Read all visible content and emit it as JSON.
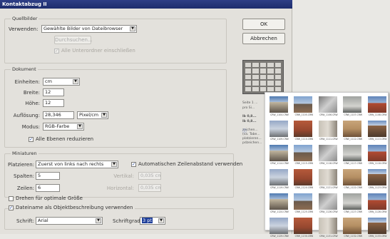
{
  "window": {
    "title": "Kontaktabzug II"
  },
  "quellbilder": {
    "legend": "Quellbilder",
    "verwenden_label": "Verwenden:",
    "verwenden_value": "Gewählte Bilder von Dateibrowser",
    "durchsuchen_label": "Durchsuchen...",
    "unterordner_label": "Alle Unterordner einschließen",
    "unterordner_checked": true
  },
  "dokument": {
    "legend": "Dokument",
    "einheiten_label": "Einheiten:",
    "einheiten_value": "cm",
    "breite_label": "Breite:",
    "breite_value": "12",
    "hoehe_label": "Höhe:",
    "hoehe_value": "12",
    "aufloesung_label": "Auflösung:",
    "aufloesung_value": "28,346",
    "aufloesung_unit": "Pixel/cm",
    "modus_label": "Modus:",
    "modus_value": "RGB-Farbe",
    "ebenen_label": "Alle Ebenen reduzieren",
    "ebenen_checked": true
  },
  "miniaturen": {
    "legend": "Miniaturen",
    "platzieren_label": "Platzieren:",
    "platzieren_value": "Zuerst von links nach rechts",
    "auto_abstand_label": "Automatischen Zeilenabstand verwenden",
    "auto_abstand_checked": true,
    "spalten_label": "Spalten:",
    "spalten_value": "5",
    "zeilen_label": "Zeilen:",
    "zeilen_value": "6",
    "vertikal_label": "Vertikal:",
    "vertikal_value": "0,035 cm",
    "horizontal_label": "Horizontal:",
    "horizontal_value": "0,035 cm",
    "drehen_label": "Drehen für optimale Größe",
    "drehen_checked": false
  },
  "dateiname": {
    "legend_checkbox_label": "Dateiname als Objektbeschreibung verwenden",
    "legend_checked": true,
    "schrift_label": "Schrift:",
    "schrift_value": "Arial",
    "schriftgrad_label": "Schriftgrad:",
    "schriftgrad_value": "3 pt"
  },
  "buttons": {
    "ok": "OK",
    "abbrechen": "Abbrechen"
  },
  "info": {
    "lines": [
      "Seite 1 ...",
      "pro Si...",
      "Ib 0,8...",
      "Ib 0,8...",
      "zeichen...",
      "(ca. Tabe...",
      "platzieren...",
      "pdzeichen..."
    ]
  },
  "contact_sheet": {
    "captions": [
      "CRW_1104.CRW",
      "CRW_1105.CRW",
      "CRW_1106.CRW",
      "CRW_1107.CRW",
      "CRW_1108.CRW",
      "CRW_1109.CRW",
      "CRW_1110.CRW",
      "CRW_1111.CRW",
      "CRW_1112.CRW",
      "CRW_1113.CRW",
      "CRW_1114.CRW",
      "CRW_1115.CRW",
      "CRW_1116.CRW",
      "CRW_1117.CRW",
      "CRW_1118.CRW",
      "CRW_1119.CRW",
      "CRW_1120.CRW",
      "CRW_1121.CRW",
      "CRW_1122.CRW",
      "CRW_1123.CRW",
      "CRW_1124.CRW",
      "CRW_1125.CRW",
      "CRW_1126.CRW",
      "CRW_1127.CRW",
      "CRW_1128.CRW",
      "CRW_1129.CRW",
      "CRW_1130.CRW",
      "CRW_1131.CRW",
      "CRW_1132.CRW",
      "CRW_1133.CRW"
    ]
  }
}
